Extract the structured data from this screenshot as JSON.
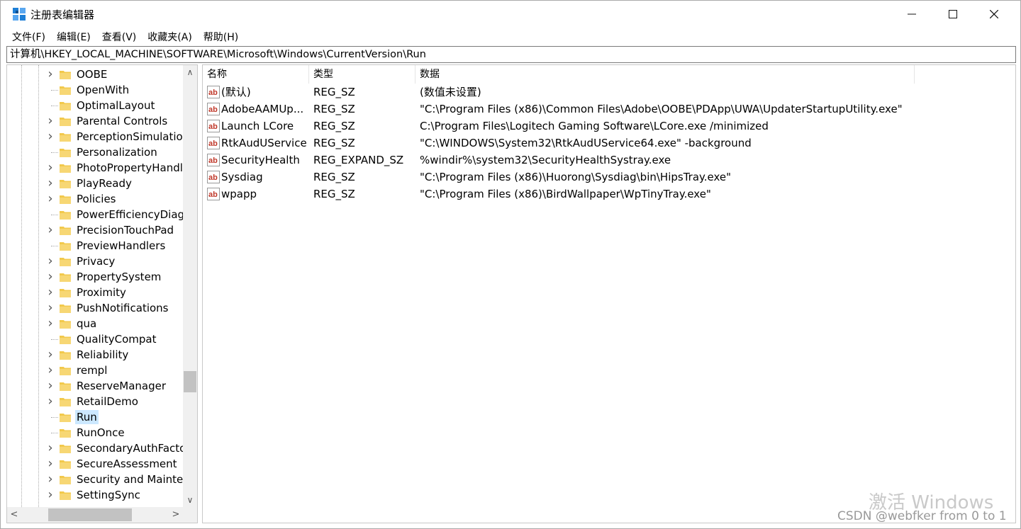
{
  "window": {
    "title": "注册表编辑器",
    "controls": {
      "minimize": "—",
      "maximize": "☐",
      "close": "✕"
    }
  },
  "menu": [
    "文件(F)",
    "编辑(E)",
    "查看(V)",
    "收藏夹(A)",
    "帮助(H)"
  ],
  "address": "计算机\\HKEY_LOCAL_MACHINE\\SOFTWARE\\Microsoft\\Windows\\CurrentVersion\\Run",
  "tree": {
    "items": [
      {
        "label": "OOBE",
        "expandable": true
      },
      {
        "label": "OpenWith",
        "expandable": false
      },
      {
        "label": "OptimalLayout",
        "expandable": false
      },
      {
        "label": "Parental Controls",
        "expandable": true
      },
      {
        "label": "PerceptionSimulation",
        "expandable": true
      },
      {
        "label": "Personalization",
        "expandable": false
      },
      {
        "label": "PhotoPropertyHandl",
        "expandable": true
      },
      {
        "label": "PlayReady",
        "expandable": true
      },
      {
        "label": "Policies",
        "expandable": true
      },
      {
        "label": "PowerEfficiencyDiagr",
        "expandable": false
      },
      {
        "label": "PrecisionTouchPad",
        "expandable": true
      },
      {
        "label": "PreviewHandlers",
        "expandable": false
      },
      {
        "label": "Privacy",
        "expandable": true
      },
      {
        "label": "PropertySystem",
        "expandable": true
      },
      {
        "label": "Proximity",
        "expandable": true
      },
      {
        "label": "PushNotifications",
        "expandable": true
      },
      {
        "label": "qua",
        "expandable": true
      },
      {
        "label": "QualityCompat",
        "expandable": false
      },
      {
        "label": "Reliability",
        "expandable": true
      },
      {
        "label": "rempl",
        "expandable": true
      },
      {
        "label": "ReserveManager",
        "expandable": true
      },
      {
        "label": "RetailDemo",
        "expandable": true
      },
      {
        "label": "Run",
        "expandable": false,
        "selected": true
      },
      {
        "label": "RunOnce",
        "expandable": false
      },
      {
        "label": "SecondaryAuthFacto",
        "expandable": true
      },
      {
        "label": "SecureAssessment",
        "expandable": true
      },
      {
        "label": "Security and Mainter",
        "expandable": true
      },
      {
        "label": "SettingSync",
        "expandable": true
      }
    ]
  },
  "list": {
    "headers": {
      "name": "名称",
      "type": "类型",
      "data": "数据"
    },
    "rows": [
      {
        "name": "(默认)",
        "type": "REG_SZ",
        "data": "(数值未设置)"
      },
      {
        "name": "AdobeAAMUp...",
        "type": "REG_SZ",
        "data": "\"C:\\Program Files (x86)\\Common Files\\Adobe\\OOBE\\PDApp\\UWA\\UpdaterStartupUtility.exe\""
      },
      {
        "name": "Launch LCore",
        "type": "REG_SZ",
        "data": "C:\\Program Files\\Logitech Gaming Software\\LCore.exe /minimized"
      },
      {
        "name": "RtkAudUService",
        "type": "REG_SZ",
        "data": "\"C:\\WINDOWS\\System32\\RtkAudUService64.exe\" -background"
      },
      {
        "name": "SecurityHealth",
        "type": "REG_EXPAND_SZ",
        "data": "%windir%\\system32\\SecurityHealthSystray.exe"
      },
      {
        "name": "Sysdiag",
        "type": "REG_SZ",
        "data": "\"C:\\Program Files (x86)\\Huorong\\Sysdiag\\bin\\HipsTray.exe\""
      },
      {
        "name": "wpapp",
        "type": "REG_SZ",
        "data": "\"C:\\Program Files (x86)\\BirdWallpaper\\WpTinyTray.exe\""
      }
    ]
  },
  "overlay": {
    "activation": "激活 Windows",
    "credit": "CSDN @webfker from 0 to 1"
  },
  "colors": {
    "selection": "#cce8ff",
    "folder": "#f2c94c",
    "regIcon": "#c0392b"
  }
}
